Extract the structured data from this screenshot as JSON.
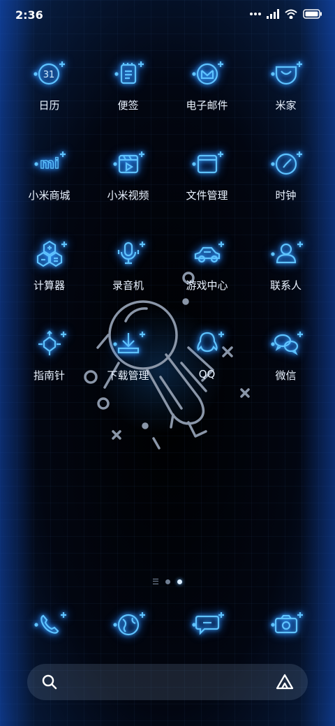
{
  "status_bar": {
    "time": "2:36",
    "icons": [
      "dots-icon",
      "signal-icon",
      "wifi-icon",
      "battery-icon"
    ]
  },
  "apps": [
    {
      "label": "日历",
      "icon": "calendar-icon",
      "day": "31"
    },
    {
      "label": "便签",
      "icon": "notes-icon"
    },
    {
      "label": "电子邮件",
      "icon": "email-icon"
    },
    {
      "label": "米家",
      "icon": "mijia-icon"
    },
    {
      "label": "小米商城",
      "icon": "mi-store-icon",
      "logo_text": "mi"
    },
    {
      "label": "小米视频",
      "icon": "video-icon"
    },
    {
      "label": "文件管理",
      "icon": "folder-icon"
    },
    {
      "label": "时钟",
      "icon": "clock-icon"
    },
    {
      "label": "计算器",
      "icon": "calculator-icon"
    },
    {
      "label": "录音机",
      "icon": "microphone-icon"
    },
    {
      "label": "游戏中心",
      "icon": "car-icon"
    },
    {
      "label": "联系人",
      "icon": "person-icon"
    },
    {
      "label": "指南针",
      "icon": "compass-icon"
    },
    {
      "label": "下载管理",
      "icon": "download-icon"
    },
    {
      "label": "QQ",
      "icon": "qq-penguin-icon"
    },
    {
      "label": "微信",
      "icon": "wechat-icon"
    }
  ],
  "page_indicator": {
    "pages": 2,
    "active_page": 2
  },
  "dock": [
    {
      "icon": "phone-icon"
    },
    {
      "icon": "browser-globe-icon"
    },
    {
      "icon": "messages-icon"
    },
    {
      "icon": "camera-icon"
    }
  ],
  "search_bar": {
    "left_icon": "search-icon",
    "right_icon": "assistant-icon"
  },
  "colors": {
    "neon_blue": "#4fb8ff",
    "background": "#020611",
    "edge_glow": "#0b2c66",
    "label_text": "#eaf3ff"
  }
}
